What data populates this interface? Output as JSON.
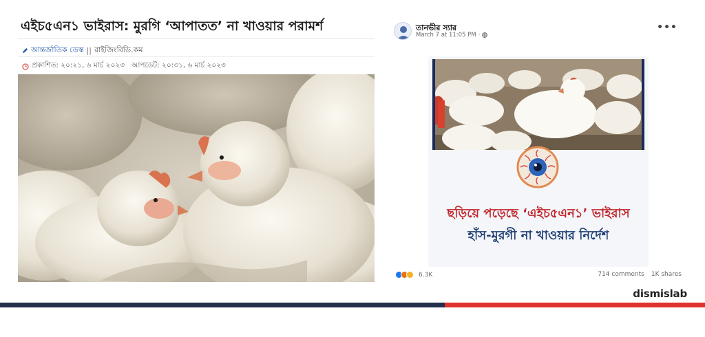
{
  "article": {
    "title": "এইচ৫এন১ ভাইরাস: মুরগি ‘আপাতত’ না খাওয়ার পরামর্শ",
    "desk": "আন্তর্জাতিক ডেস্ক",
    "separator": "||",
    "source": "রাইজিংবিডি.কম",
    "dates": "প্রকাশিত: ২০:২১, ৬ মার্চ ২০২৩   আপডেট: ২০:৩১, ৬ মার্চ ২০২৩",
    "photo_alt": "chickens-photo"
  },
  "post": {
    "author": "তানভীর স্যার",
    "time": "March 7 at 11:05 PM",
    "dot": "·",
    "more": "•••",
    "headline_line1": "ছড়িয়ে পড়েছে ‘এইচ৫এন১’ ভাইরাস",
    "headline_line2": "হাঁস-মুরগী না খাওয়ার নির্দেশ",
    "reaction_count": "6.3K",
    "comments": "714 comments",
    "shares": "1K shares",
    "reaction_icons": [
      "like-icon",
      "angry-icon",
      "wow-icon"
    ]
  },
  "footer": {
    "brand": "dismislab"
  },
  "colors": {
    "dark_bar": "#232f4b",
    "red_bar": "#e0322e",
    "headline_red": "#c0262c",
    "headline_blue": "#1f3f74",
    "link_blue": "#2a5da8"
  }
}
